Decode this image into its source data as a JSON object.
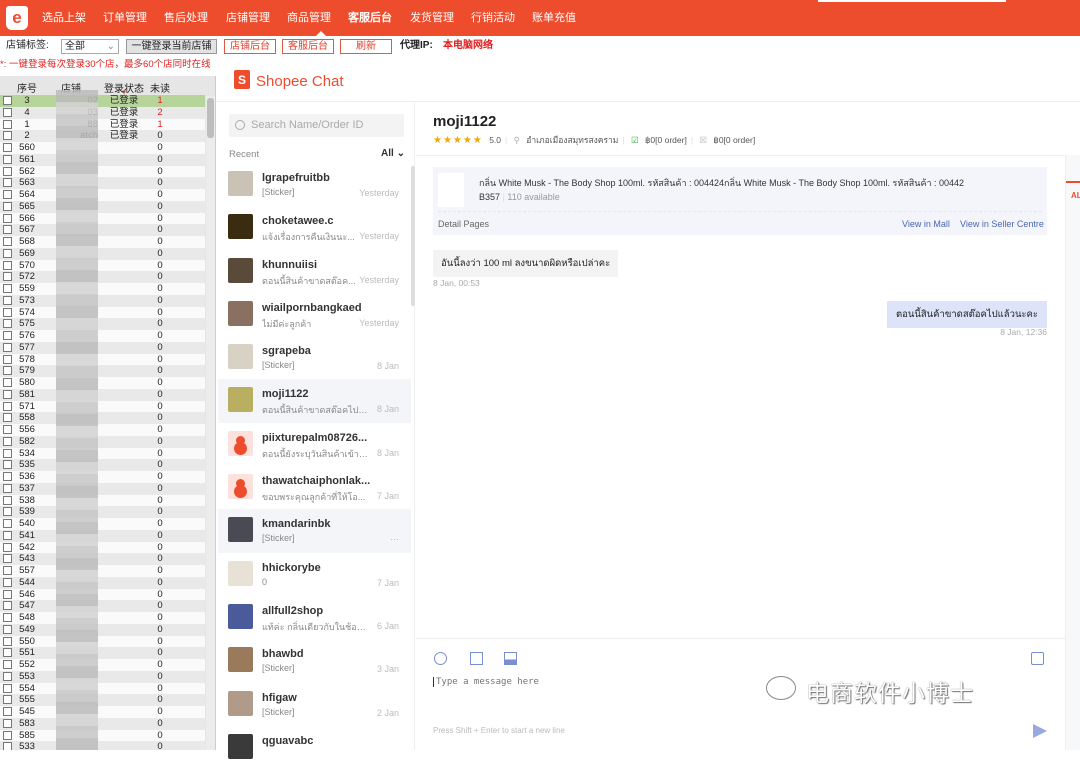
{
  "app": {
    "logo_letter": "e"
  },
  "nav": {
    "items": [
      "选品上架",
      "订单管理",
      "售后处理",
      "店铺管理",
      "商品管理",
      "客服后台",
      "发货管理",
      "行销活动",
      "账单充值"
    ],
    "active": "客服后台"
  },
  "toolbar": {
    "shop_tag_label": "店铺标签:",
    "shop_tag_value": "全部",
    "login_current": "一键登录当前店铺",
    "shop_backend": "店铺后台",
    "cs_backend": "客服后台",
    "refresh": "刷新",
    "proxy_label": "代理IP:",
    "proxy_value": "本电脑网络"
  },
  "note": "*: 一键登录每次登录30个店，最多60个店同时在线",
  "shop_table": {
    "headers": [
      "序号",
      "店铺",
      "登录状态",
      "未读"
    ],
    "rows": [
      {
        "no": "3",
        "shop": "02",
        "status": "已登录",
        "unread": "1"
      },
      {
        "no": "4",
        "shop": "03",
        "status": "已登录",
        "unread": "2"
      },
      {
        "no": "1",
        "shop": "88",
        "status": "已登录",
        "unread": "1"
      },
      {
        "no": "2",
        "shop": "atch",
        "status": "已登录",
        "unread": "0"
      },
      {
        "no": "560",
        "unread": "0"
      },
      {
        "no": "561",
        "unread": "0"
      },
      {
        "no": "562",
        "unread": "0"
      },
      {
        "no": "563",
        "unread": "0"
      },
      {
        "no": "564",
        "unread": "0"
      },
      {
        "no": "565",
        "unread": "0"
      },
      {
        "no": "566",
        "unread": "0"
      },
      {
        "no": "567",
        "unread": "0"
      },
      {
        "no": "568",
        "unread": "0"
      },
      {
        "no": "569",
        "unread": "0"
      },
      {
        "no": "570",
        "unread": "0"
      },
      {
        "no": "572",
        "unread": "0"
      },
      {
        "no": "559",
        "unread": "0"
      },
      {
        "no": "573",
        "unread": "0"
      },
      {
        "no": "574",
        "unread": "0"
      },
      {
        "no": "575",
        "unread": "0"
      },
      {
        "no": "576",
        "unread": "0"
      },
      {
        "no": "577",
        "unread": "0"
      },
      {
        "no": "578",
        "unread": "0"
      },
      {
        "no": "579",
        "unread": "0"
      },
      {
        "no": "580",
        "unread": "0"
      },
      {
        "no": "581",
        "unread": "0"
      },
      {
        "no": "571",
        "unread": "0"
      },
      {
        "no": "558",
        "unread": "0"
      },
      {
        "no": "556",
        "unread": "0"
      },
      {
        "no": "582",
        "unread": "0"
      },
      {
        "no": "534",
        "unread": "0"
      },
      {
        "no": "535",
        "unread": "0"
      },
      {
        "no": "536",
        "unread": "0"
      },
      {
        "no": "537",
        "unread": "0"
      },
      {
        "no": "538",
        "unread": "0"
      },
      {
        "no": "539",
        "unread": "0"
      },
      {
        "no": "540",
        "unread": "0"
      },
      {
        "no": "541",
        "unread": "0"
      },
      {
        "no": "542",
        "unread": "0"
      },
      {
        "no": "543",
        "unread": "0"
      },
      {
        "no": "557",
        "unread": "0"
      },
      {
        "no": "544",
        "unread": "0"
      },
      {
        "no": "546",
        "unread": "0"
      },
      {
        "no": "547",
        "unread": "0"
      },
      {
        "no": "548",
        "unread": "0"
      },
      {
        "no": "549",
        "unread": "0"
      },
      {
        "no": "550",
        "unread": "0"
      },
      {
        "no": "551",
        "unread": "0"
      },
      {
        "no": "552",
        "unread": "0"
      },
      {
        "no": "553",
        "unread": "0"
      },
      {
        "no": "554",
        "unread": "0"
      },
      {
        "no": "555",
        "unread": "0"
      },
      {
        "no": "545",
        "unread": "0"
      },
      {
        "no": "583",
        "unread": "0"
      },
      {
        "no": "585",
        "unread": "0"
      },
      {
        "no": "533",
        "unread": "0"
      }
    ]
  },
  "shopee": {
    "title": "Shopee Chat",
    "search_placeholder": "Search Name/Order ID",
    "recent_label": "Recent",
    "filter": "All"
  },
  "conversations": [
    {
      "name": "lgrapefruitbb",
      "msg": "[Sticker]",
      "date": "Yesterday",
      "avatar": "#c9c2b5"
    },
    {
      "name": "choketawee.c",
      "msg": "แจ้งเรื่องการคืนเงินนะ...",
      "date": "Yesterday",
      "avatar": "#3a2c10"
    },
    {
      "name": "khunnuiisi",
      "msg": "ตอนนี้สินค้าขาดสต๊อค...",
      "date": "Yesterday",
      "avatar": "#5a4a3a"
    },
    {
      "name": "wiailpornbangkaed",
      "msg": "ไม่มีค่ะลูกค้า",
      "date": "Yesterday",
      "avatar": "#8a7060"
    },
    {
      "name": "sgrapeba",
      "msg": "[Sticker]",
      "date": "8 Jan",
      "avatar": "#d8d2c4"
    },
    {
      "name": "moji1122",
      "msg": "ตอนนี้สินค้าขาดสต๊อคไปแน...",
      "date": "8 Jan",
      "avatar": "#b8b060"
    },
    {
      "name": "piixturepalm08726...",
      "msg": "ตอนนี้ยังระบุวันสินค้าเข้าไ...",
      "date": "8 Jan",
      "avatar": "default"
    },
    {
      "name": "thawatchaiphonlak...",
      "msg": "ขอบพระคุณลูกค้าที่ให้โอ...",
      "date": "7 Jan",
      "avatar": "default"
    },
    {
      "name": "kmandarinbk",
      "msg": "[Sticker]",
      "date": "···",
      "avatar": "#4a4a55"
    },
    {
      "name": "hhickorybe",
      "msg": "0",
      "date": "7 Jan",
      "avatar": "#e8e2d6"
    },
    {
      "name": "allfull2shop",
      "msg": "แท้ค่ะ กลิ่นเดียวกับในช้อปค่ะ",
      "date": "6 Jan",
      "avatar": "#4a5a9a"
    },
    {
      "name": "bhawbd",
      "msg": "[Sticker]",
      "date": "3 Jan",
      "avatar": "#9a7a5a"
    },
    {
      "name": "hfigaw",
      "msg": "[Sticker]",
      "date": "2 Jan",
      "avatar": "#b09a8a"
    },
    {
      "name": "qguavabc",
      "msg": "",
      "date": "",
      "avatar": "#3a3a3a"
    }
  ],
  "chat": {
    "name": "moji1122",
    "stars": "★★★★★",
    "rating": "5.0",
    "location": "อำเภอเมืองสมุทรสงคราม",
    "orders1": "฿0[0 order]",
    "orders2": "฿0[0 order]",
    "product": {
      "title": "กลิ่น White Musk - The Body Shop 100ml. รหัสสินค้า : 004424กลิ่น White Musk - The Body Shop 100ml. รหัสสินค้า : 00442",
      "price": "B357",
      "available": "110 available",
      "detail": "Detail Pages",
      "view_mall": "View in Mall",
      "view_seller": "View in Seller Centre"
    },
    "messages": [
      {
        "text": "อันนี้ลงว่า 100 ml ลงขนาดผิดหรือเปล่าคะ",
        "time": "8 Jan, 00:53"
      },
      {
        "text": "ตอนนี้สินค้าขาดสต๊อคไปแล้วนะคะ",
        "time": "8 Jan, 12:36"
      }
    ],
    "input_placeholder": "Type a message here",
    "hint": "Press Shift + Enter to start a new line"
  },
  "right_panel": {
    "tab": "AL"
  },
  "watermark": "电商软件小博士",
  "colors": {
    "brand": "#ee4d2d",
    "link": "#4a66b0",
    "selected_row": "#b7d59a"
  }
}
